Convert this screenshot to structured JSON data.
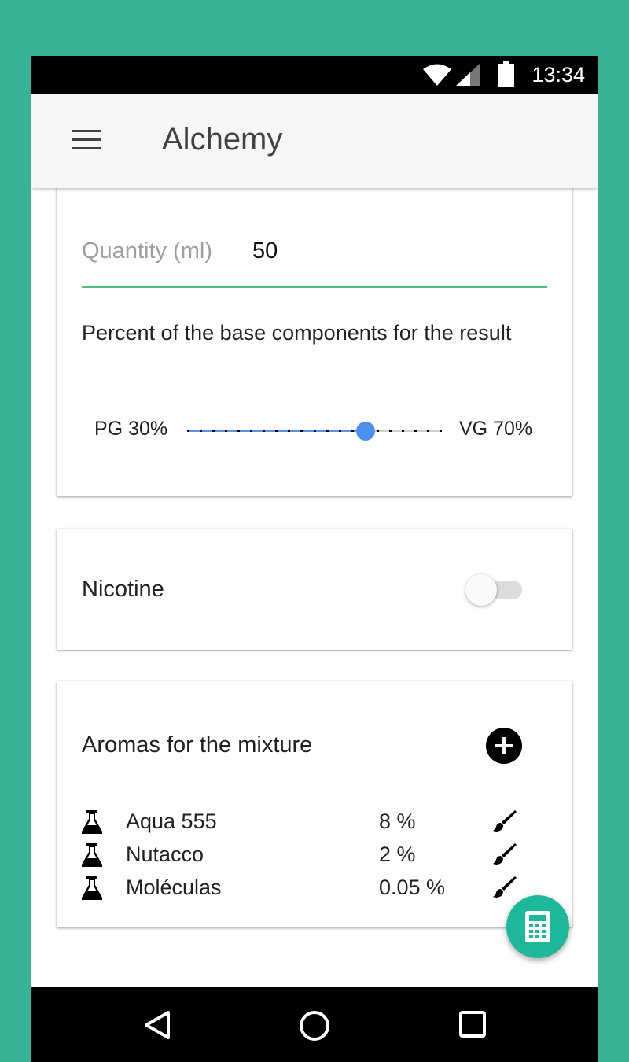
{
  "status_bar": {
    "time": "13:34"
  },
  "app_bar": {
    "title": "Alchemy"
  },
  "base_card": {
    "quantity_label": "Quantity (ml)",
    "quantity_value": "50",
    "percent_text": "Percent of the base components for the result",
    "pg_label": "PG 30%",
    "vg_label": "VG 70%",
    "slider_pg_fraction": 0.7
  },
  "nicotine_card": {
    "label": "Nicotine",
    "enabled": false
  },
  "aromas_card": {
    "title": "Aromas for the mixture",
    "items": [
      {
        "name": "Aqua 555",
        "percent": "8 %"
      },
      {
        "name": "Nutacco",
        "percent": "2 %"
      },
      {
        "name": "Moléculas",
        "percent": "0.05 %"
      }
    ]
  },
  "colors": {
    "background": "#36b397",
    "accent_line": "#4cc37a",
    "slider": "#4d8ff0",
    "fab": "#1db899"
  },
  "icons": {
    "menu": "menu-icon",
    "add": "add-circle-icon",
    "flask": "flask-icon",
    "brush": "brush-icon",
    "fab": "calculator-icon",
    "nav_back": "back-icon",
    "nav_home": "home-icon",
    "nav_recent": "recent-apps-icon"
  }
}
